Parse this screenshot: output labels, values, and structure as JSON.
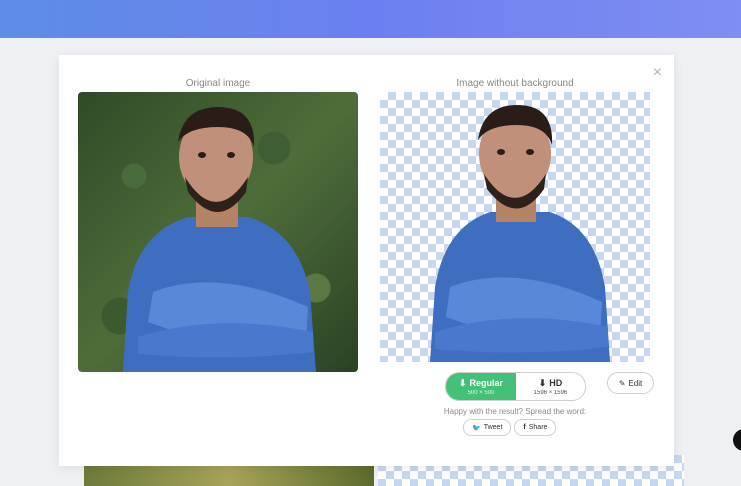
{
  "modal": {
    "close_glyph": "×",
    "original_caption": "Original image",
    "result_caption": "Image without background"
  },
  "download": {
    "regular": {
      "label": "Regular",
      "size": "500 × 500"
    },
    "hd": {
      "label": "HD",
      "size": "1596 × 1596"
    }
  },
  "edit_label": "Edit",
  "spread": {
    "text": "Happy with the result? Spread the word:",
    "tweet_label": "Tweet",
    "share_label": "Share"
  },
  "colors": {
    "accent_green": "#44c178",
    "header_gradient_start": "#5d8de6",
    "header_gradient_end": "#7d8ff2",
    "checker": "#c9d6ef"
  },
  "icons": {
    "download": "download-icon",
    "edit": "pencil-icon",
    "tweet": "twitter-icon",
    "share": "facebook-icon",
    "close": "close-icon"
  }
}
